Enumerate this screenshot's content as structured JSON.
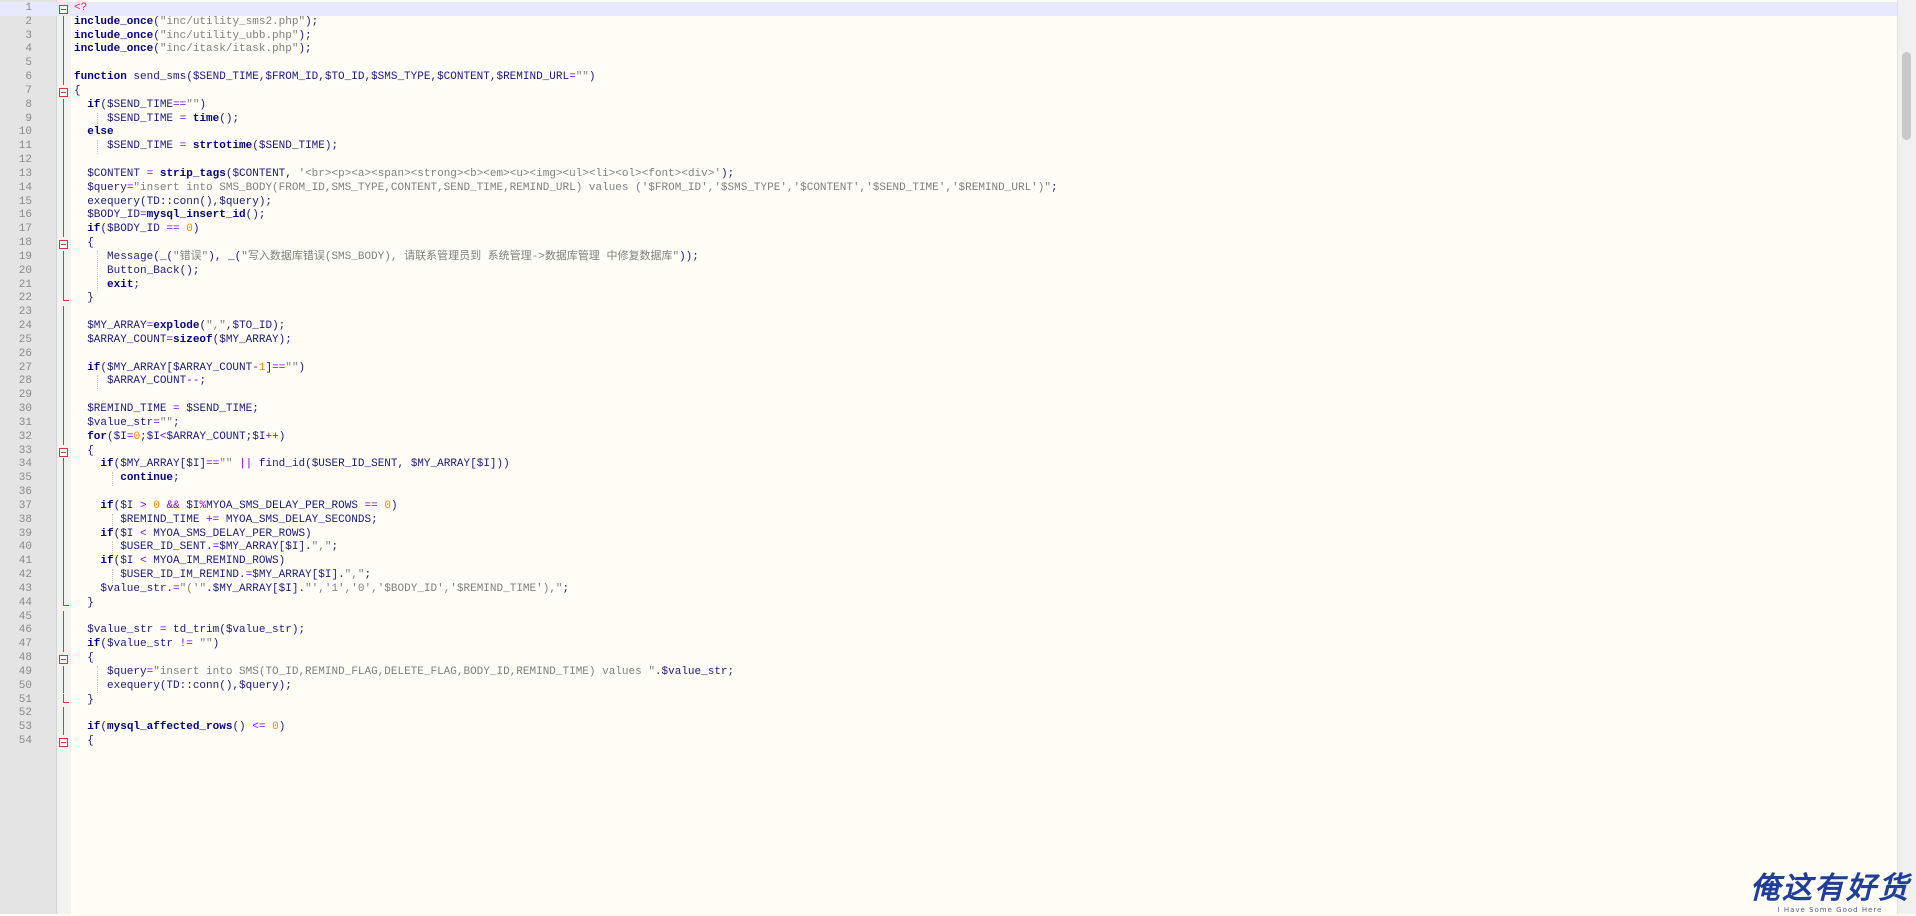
{
  "editor": {
    "current_line": 1,
    "lines": [
      {
        "n": "1",
        "text": "<?"
      },
      {
        "n": "2",
        "text": "include_once(\"inc/utility_sms2.php\");"
      },
      {
        "n": "3",
        "text": "include_once(\"inc/utility_ubb.php\");"
      },
      {
        "n": "4",
        "text": "include_once(\"inc/itask/itask.php\");"
      },
      {
        "n": "5",
        "text": ""
      },
      {
        "n": "6",
        "text": "function send_sms($SEND_TIME,$FROM_ID,$TO_ID,$SMS_TYPE,$CONTENT,$REMIND_URL=\"\")"
      },
      {
        "n": "7",
        "text": "{"
      },
      {
        "n": "8",
        "text": "  if($SEND_TIME==\"\")"
      },
      {
        "n": "9",
        "text": "     $SEND_TIME = time();"
      },
      {
        "n": "10",
        "text": "  else"
      },
      {
        "n": "11",
        "text": "     $SEND_TIME = strtotime($SEND_TIME);"
      },
      {
        "n": "12",
        "text": ""
      },
      {
        "n": "13",
        "text": "  $CONTENT = strip_tags($CONTENT, '<br><p><a><span><strong><b><em><u><img><ul><li><ol><font><div>');"
      },
      {
        "n": "14",
        "text": "  $query=\"insert into SMS_BODY(FROM_ID,SMS_TYPE,CONTENT,SEND_TIME,REMIND_URL) values ('$FROM_ID','$SMS_TYPE','$CONTENT','$SEND_TIME','$REMIND_URL')\";"
      },
      {
        "n": "15",
        "text": "  exequery(TD::conn(),$query);"
      },
      {
        "n": "16",
        "text": "  $BODY_ID=mysql_insert_id();"
      },
      {
        "n": "17",
        "text": "  if($BODY_ID == 0)"
      },
      {
        "n": "18",
        "text": "  {"
      },
      {
        "n": "19",
        "text": "     Message(_(\"错误\"), _(\"写入数据库错误(SMS_BODY), 请联系管理员到 系统管理->数据库管理 中修复数据库\"));"
      },
      {
        "n": "20",
        "text": "     Button_Back();"
      },
      {
        "n": "21",
        "text": "     exit;"
      },
      {
        "n": "22",
        "text": "  }"
      },
      {
        "n": "23",
        "text": ""
      },
      {
        "n": "24",
        "text": "  $MY_ARRAY=explode(\",\",$TO_ID);"
      },
      {
        "n": "25",
        "text": "  $ARRAY_COUNT=sizeof($MY_ARRAY);"
      },
      {
        "n": "26",
        "text": ""
      },
      {
        "n": "27",
        "text": "  if($MY_ARRAY[$ARRAY_COUNT-1]==\"\")"
      },
      {
        "n": "28",
        "text": "     $ARRAY_COUNT--;"
      },
      {
        "n": "29",
        "text": ""
      },
      {
        "n": "30",
        "text": "  $REMIND_TIME = $SEND_TIME;"
      },
      {
        "n": "31",
        "text": "  $value_str=\"\";"
      },
      {
        "n": "32",
        "text": "  for($I=0;$I<$ARRAY_COUNT;$I++)"
      },
      {
        "n": "33",
        "text": "  {"
      },
      {
        "n": "34",
        "text": "    if($MY_ARRAY[$I]==\"\" || find_id($USER_ID_SENT, $MY_ARRAY[$I]))"
      },
      {
        "n": "35",
        "text": "       continue;"
      },
      {
        "n": "36",
        "text": ""
      },
      {
        "n": "37",
        "text": "    if($I > 0 && $I%MYOA_SMS_DELAY_PER_ROWS == 0)"
      },
      {
        "n": "38",
        "text": "       $REMIND_TIME += MYOA_SMS_DELAY_SECONDS;"
      },
      {
        "n": "39",
        "text": "    if($I < MYOA_SMS_DELAY_PER_ROWS)"
      },
      {
        "n": "40",
        "text": "       $USER_ID_SENT.=$MY_ARRAY[$I].\",\";"
      },
      {
        "n": "41",
        "text": "    if($I < MYOA_IM_REMIND_ROWS)"
      },
      {
        "n": "42",
        "text": "       $USER_ID_IM_REMIND.=$MY_ARRAY[$I].\",\";"
      },
      {
        "n": "43",
        "text": "    $value_str.=\"('\".$MY_ARRAY[$I].\"','1','0','$BODY_ID','$REMIND_TIME'),\";"
      },
      {
        "n": "44",
        "text": "  }"
      },
      {
        "n": "45",
        "text": ""
      },
      {
        "n": "46",
        "text": "  $value_str = td_trim($value_str);"
      },
      {
        "n": "47",
        "text": "  if($value_str != \"\")"
      },
      {
        "n": "48",
        "text": "  {"
      },
      {
        "n": "49",
        "text": "     $query=\"insert into SMS(TO_ID,REMIND_FLAG,DELETE_FLAG,BODY_ID,REMIND_TIME) values \".$value_str;"
      },
      {
        "n": "50",
        "text": "     exequery(TD::conn(),$query);"
      },
      {
        "n": "51",
        "text": "  }"
      },
      {
        "n": "52",
        "text": ""
      },
      {
        "n": "53",
        "text": "  if(mysql_affected_rows() <= 0)"
      },
      {
        "n": "54",
        "text": "  {"
      }
    ]
  },
  "watermark": {
    "main": "俺这有好货",
    "sub": "I Have Some Good Here"
  },
  "colors": {
    "keyword": "#00008b",
    "number": "#ff8000",
    "string": "#808080",
    "variable": "#1a1a80",
    "fold_marker": "#dd3333",
    "gutter": "#e4e4e4",
    "background": "#fffdf5",
    "current_line": "#e8e8ff"
  }
}
